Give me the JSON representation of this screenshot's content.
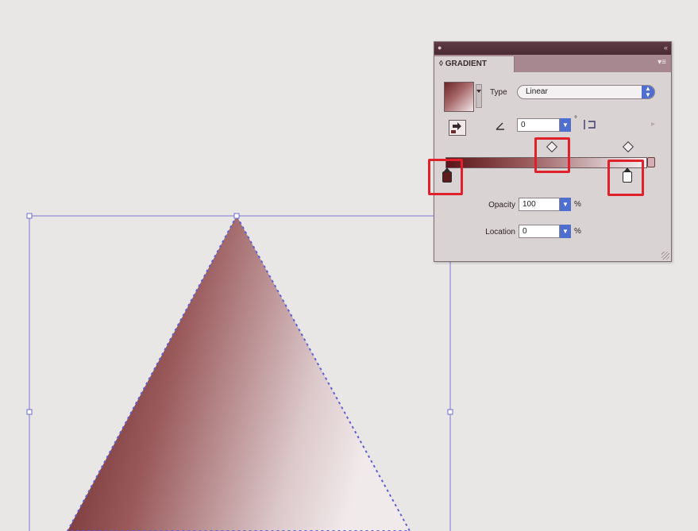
{
  "panel": {
    "tab_label": "GRADIENT",
    "tab_prefix_icon": "double-arrow-icon",
    "type_label": "Type",
    "type_value": "Linear",
    "angle_value": "0",
    "angle_unit": "°",
    "opacity_label": "Opacity",
    "opacity_value": "100",
    "opacity_unit": "%",
    "location_label": "Location",
    "location_value": "0",
    "location_unit": "%",
    "gradient_start_color": "#5a1417",
    "gradient_end_color": "#f4eff0"
  },
  "colors": {
    "highlight": "#e0202a",
    "selection": "#6b6bd0"
  }
}
